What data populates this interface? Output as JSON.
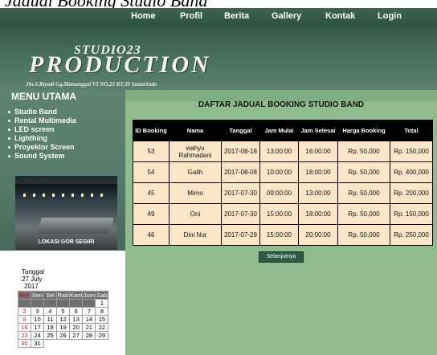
{
  "page_heading": "Jadual Booking Studio Band",
  "nav": [
    "Home",
    "Profil",
    "Berita",
    "Gallery",
    "Kontak",
    "Login"
  ],
  "logo": {
    "small": "STUDIO23",
    "big": "PRODUCTION",
    "address": "Jln.S.Riyadi Gg.Manunggal VI NO.23 RT.39 Samarinda"
  },
  "sidebar": {
    "title": "MENU UTAMA",
    "items": [
      "Studio Band",
      "Rental Multimedia",
      "LED screen",
      "Lighthing",
      "Proyektor Screen",
      "Sound System"
    ],
    "photo_caption": "LOKASI GOR SEGIRI"
  },
  "main": {
    "title": "DAFTAR JADUAL BOOKING STUDIO BAND",
    "columns": [
      "ID Booking",
      "Nama",
      "Tanggal",
      "Jam Mulai",
      "Jam Selesai",
      "Harga Booking",
      "Total"
    ],
    "rows": [
      [
        "53",
        "wahyu Rahmadani",
        "2017-08-18",
        "13:00:00",
        "16:00:00",
        "Rp. 50,000",
        "Rp. 150,000"
      ],
      [
        "54",
        "Galih",
        "2017-08-08",
        "10:00:00",
        "18:00:00",
        "Rp. 50,000",
        "Rp. 400,000"
      ],
      [
        "45",
        "Mimo",
        "2017-07-30",
        "09:00:00",
        "13:00:00",
        "Rp. 50,000",
        "Rp. 200,000"
      ],
      [
        "49",
        "Oni",
        "2017-07-30",
        "15:00:00",
        "18:00:00",
        "Rp. 50,000",
        "Rp. 150,000"
      ],
      [
        "46",
        "Dini Nur",
        "2017-07-29",
        "15:00:00",
        "20:00:00",
        "Rp. 50,000",
        "Rp. 250,000"
      ]
    ],
    "next_button": "Selanjutnya"
  },
  "calendar": {
    "label": "Tanggal",
    "day_month": "27 July",
    "year": "2017",
    "weekdays": [
      "Min",
      "Sen",
      "Sel",
      "Rab",
      "Kam",
      "Jum",
      "Sab"
    ],
    "weeks": [
      [
        "",
        "",
        "",
        "",
        "",
        "",
        "1"
      ],
      [
        "2",
        "3",
        "4",
        "5",
        "6",
        "7",
        "8"
      ],
      [
        "9",
        "10",
        "11",
        "12",
        "13",
        "14",
        "15"
      ],
      [
        "16",
        "17",
        "18",
        "19",
        "20",
        "21",
        "22"
      ],
      [
        "23",
        "24",
        "25",
        "26",
        "27",
        "28",
        "29"
      ],
      [
        "30",
        "31",
        "",
        "",
        "",
        "",
        ""
      ]
    ]
  }
}
